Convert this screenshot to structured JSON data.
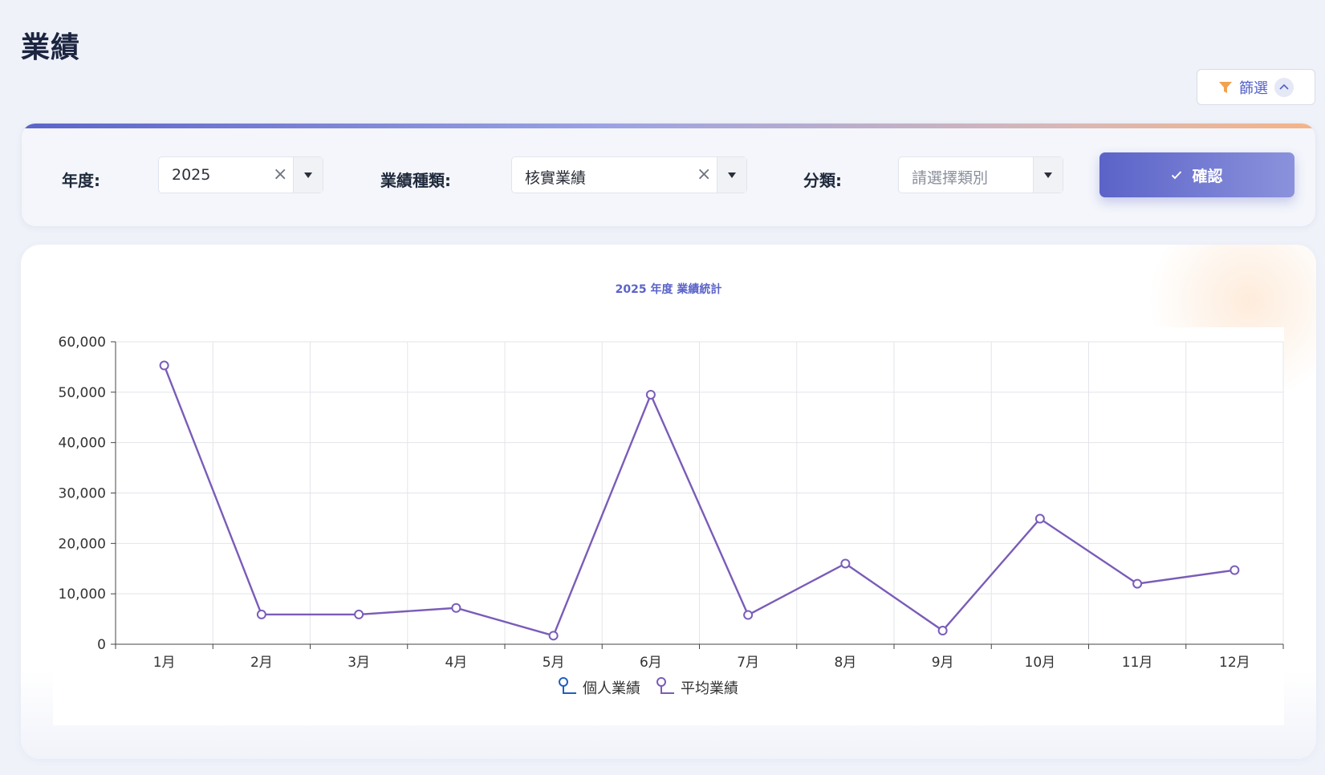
{
  "page": {
    "title": "業績"
  },
  "filter_toggle": {
    "label": "篩選"
  },
  "filters": {
    "year": {
      "label": "年度:",
      "value": "2025"
    },
    "type": {
      "label": "業績種類:",
      "value": "核實業績"
    },
    "category": {
      "label": "分類:",
      "placeholder": "請選擇類別"
    },
    "confirm_label": "確認"
  },
  "colors": {
    "accent": "#5b63c8",
    "series_line": "#7a5cb8",
    "legend_personal": "#1f5fbf"
  },
  "chart_data": {
    "type": "line",
    "title": "2025 年度 業績統計",
    "categories": [
      "1月",
      "2月",
      "3月",
      "4月",
      "5月",
      "6月",
      "7月",
      "8月",
      "9月",
      "10月",
      "11月",
      "12月"
    ],
    "series": [
      {
        "name": "個人業績",
        "values": []
      },
      {
        "name": "平均業績",
        "values": [
          55300,
          5900,
          5900,
          7200,
          1700,
          49500,
          5800,
          16000,
          2700,
          24900,
          12000,
          14700
        ]
      }
    ],
    "ylim": [
      0,
      60000
    ],
    "yticks": [
      "0",
      "10,000",
      "20,000",
      "30,000",
      "40,000",
      "50,000",
      "60,000"
    ],
    "grid": true,
    "legend": "bottom"
  }
}
